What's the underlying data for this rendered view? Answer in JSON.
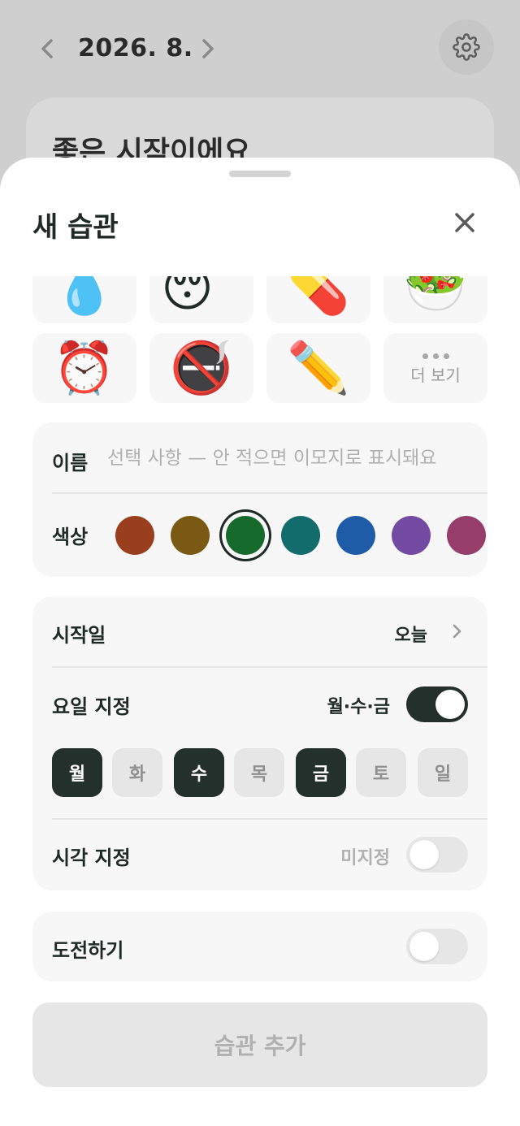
{
  "background": {
    "month_label": "2026. 8.",
    "prev_icon": "chevron-left-icon",
    "next_icon": "chevron-right-icon",
    "settings_icon": "gear-icon",
    "card_title": "좋은 시작이에요"
  },
  "sheet": {
    "title": "새 습관",
    "close_icon": "close-icon"
  },
  "emoji_picker": {
    "row1": [
      "💧",
      "😴",
      "💊",
      "🥗"
    ],
    "row2": [
      "⏰",
      "🚭",
      "✏️"
    ],
    "more_label": "더 보기",
    "more_icon": "ellipsis-icon"
  },
  "name_field": {
    "label": "이름",
    "value": "",
    "placeholder": "선택 사항 — 안 적으면 이모지로 표시돼요"
  },
  "color_field": {
    "label": "색상",
    "options": [
      "#9a3f1e",
      "#7a5a12",
      "#166b2c",
      "#116c6b",
      "#1e5ca8",
      "#744ba3",
      "#963d6a"
    ],
    "selected_index": 2
  },
  "start_date": {
    "label": "시작일",
    "value": "오늘"
  },
  "weekday": {
    "label": "요일 지정",
    "summary": "월·수·금",
    "enabled": true,
    "days": [
      {
        "label": "월",
        "selected": true
      },
      {
        "label": "화",
        "selected": false
      },
      {
        "label": "수",
        "selected": true
      },
      {
        "label": "목",
        "selected": false
      },
      {
        "label": "금",
        "selected": true
      },
      {
        "label": "토",
        "selected": false
      },
      {
        "label": "일",
        "selected": false
      }
    ]
  },
  "time": {
    "label": "시각 지정",
    "value": "미지정",
    "enabled": false
  },
  "challenge": {
    "label": "도전하기",
    "enabled": false
  },
  "submit": {
    "label": "습관 추가"
  },
  "colors": {
    "accent_dark": "#24302c",
    "disabled_text": "#b0b0b0",
    "card_bg": "#f7f7f7"
  }
}
